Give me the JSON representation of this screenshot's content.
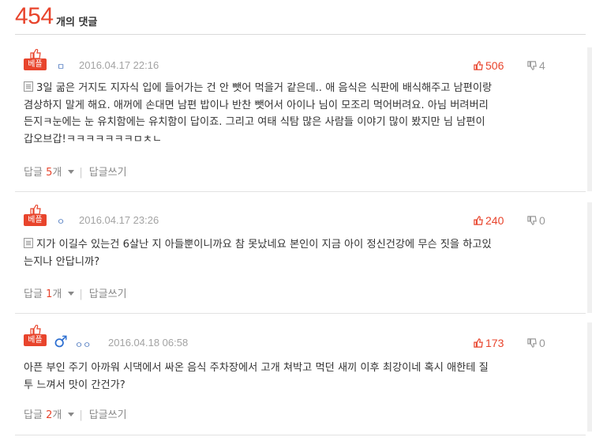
{
  "header": {
    "count": "454",
    "count_label": "개의 댓글"
  },
  "badge_label": "베플",
  "reply_label": "답글",
  "reply_unit": "개",
  "write_reply_label": "답글쓰기",
  "comments": [
    {
      "grade": "ㅁ",
      "date": "2016.04.17 22:16",
      "likes": "506",
      "dislikes": "4",
      "lines": [
        "3일 굶은 거지도 지자식 입에 들어가는 건 안 뺏어 먹을거 같은데.. 애 음식은 식판에 배식해주고 남편이랑",
        "겸상하지 말게 해요. 애꺼에 손대면 남편 밥이나 반찬 뺏어서 아이나 님이 모조리 먹어버려요. 아님 버려버리",
        "든지ㅋ눈에는 눈 유치함에는 유치함이 답이죠. 그리고 여태 식탐 많은 사람들 이야기 많이 봤지만 님 남편이",
        "갑오브갑!ㅋㅋㅋㅋㅋㅋㅋㅁㅊㄴ"
      ],
      "reply_count": "5"
    },
    {
      "grade": "ㅇ",
      "date": "2016.04.17 23:26",
      "likes": "240",
      "dislikes": "0",
      "lines": [
        "지가 이길수 있는건 6살난 지 아들뿐이니까요 참 못났네요 본인이 지금 아이 정신건강에 무슨 짓을 하고있",
        "는지나 안답니까?"
      ],
      "reply_count": "1"
    },
    {
      "grade": "ㅇㅇ",
      "gender": "♂",
      "date": "2016.04.18 06:58",
      "likes": "173",
      "dislikes": "0",
      "lines": [
        "아픈 부인 주기 아까워 시댁에서 싸온 음식 주차장에서 고개 쳐박고 먹던 새끼 이후 최강이네 혹시 애한테 질",
        "투 느껴서 맛이 간건가?"
      ],
      "reply_count": "2"
    }
  ],
  "colors": {
    "accent": "#e8442c",
    "muted": "#a3a3a3",
    "grade": "#5b83c4",
    "male": "#2d6fd1"
  },
  "icons": {
    "best": "thumbs-up-badge-icon",
    "like": "thumbs-up-icon",
    "dislike": "thumbs-down-icon",
    "doc": "document-icon",
    "caret": "caret-down-icon"
  }
}
